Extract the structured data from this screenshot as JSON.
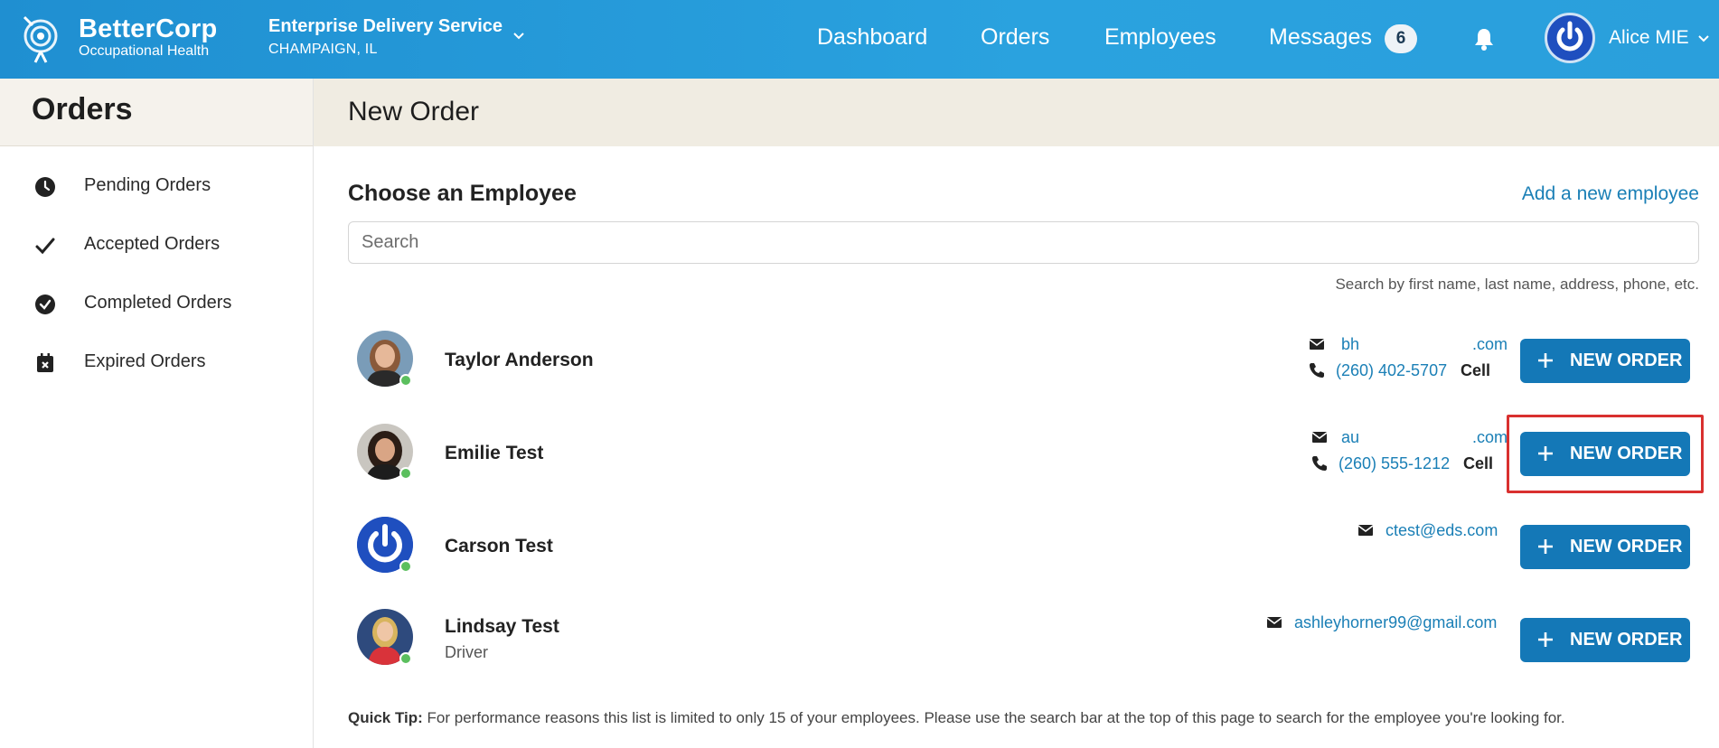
{
  "header": {
    "brand_name": "BetterCorp",
    "brand_sub": "Occupational Health",
    "org_name": "Enterprise Delivery Service",
    "org_location": "CHAMPAIGN, IL",
    "nav": [
      "Dashboard",
      "Orders",
      "Employees",
      "Messages"
    ],
    "messages_count": "6",
    "user_name": "Alice MIE"
  },
  "sidebar": {
    "title": "Orders",
    "items": [
      {
        "label": "Pending Orders",
        "icon": "clock-icon"
      },
      {
        "label": "Accepted Orders",
        "icon": "checkmark-icon"
      },
      {
        "label": "Completed Orders",
        "icon": "check-circle-icon"
      },
      {
        "label": "Expired Orders",
        "icon": "calendar-x-icon"
      }
    ]
  },
  "main": {
    "title": "New Order",
    "section_title": "Choose an Employee",
    "add_employee": "Add a new employee",
    "search_placeholder": "Search",
    "search_hint": "Search by first name, last name, address, phone, etc.",
    "new_order_label": "NEW ORDER",
    "employees": [
      {
        "name": "Taylor Anderson",
        "role": "",
        "email": "bh                         .com",
        "phone": "(260) 402-5707",
        "phone_type": "Cell"
      },
      {
        "name": "Emilie Test",
        "role": "",
        "email": "au                         .com",
        "phone": "(260) 555-1212",
        "phone_type": "Cell"
      },
      {
        "name": "Carson Test",
        "role": "",
        "email": "ctest@eds.com",
        "phone": "",
        "phone_type": ""
      },
      {
        "name": "Lindsay Test",
        "role": "Driver",
        "email": "ashleyhorner99@gmail.com",
        "phone": "",
        "phone_type": ""
      }
    ],
    "tip_label": "Quick Tip:",
    "tip_text": "For performance reasons this list is limited to only 15 of your employees. Please use the search bar at the top of this page to search for the employee you're looking for."
  },
  "colors": {
    "header": "#2aa2df",
    "accent": "#1478b7",
    "link": "#1a7fb6",
    "online": "#5bbf5e",
    "highlight": "#d9302f"
  }
}
